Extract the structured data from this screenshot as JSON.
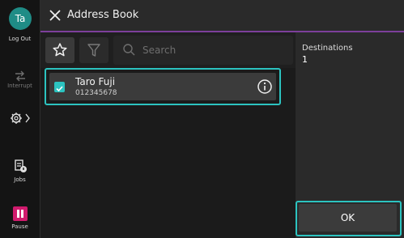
{
  "rail": {
    "avatar_initials": "Ta",
    "logout_label": "Log Out",
    "interrupt_label": "Interrupt",
    "jobs_label": "Jobs",
    "pause_label": "Pause"
  },
  "header": {
    "title": "Address Book"
  },
  "toolbar": {
    "search_placeholder": "Search"
  },
  "list": {
    "items": [
      {
        "name": "Taro Fuji",
        "number": "012345678",
        "checked": true
      }
    ]
  },
  "right_panel": {
    "destinations_label": "Destinations",
    "destinations_count": "1",
    "ok_label": "OK"
  },
  "colors": {
    "accent": "#2cc3c0",
    "header_underline": "#7d3f9b",
    "avatar": "#1f8c86",
    "pause": "#d01b6d"
  }
}
